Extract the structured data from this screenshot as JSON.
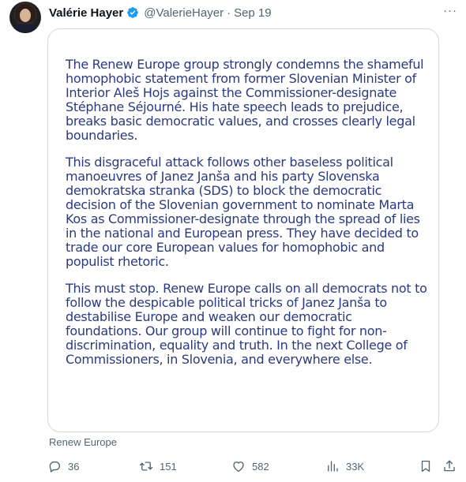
{
  "tweet": {
    "author_name": "Valérie Hayer",
    "handle": "@ValerieHayer",
    "separator": "·",
    "date": "Sep 19",
    "more_label": "···",
    "source_label": "Renew Europe"
  },
  "statement": {
    "paragraphs": [
      "The Renew Europe group strongly condemns the shameful homophobic statement from former Slovenian Minister of Interior Aleš Hojs against the Commissioner-designate Stéphane Séjourné. His hate speech leads to prejudice, breaks basic democratic values, and crosses clearly legal boundaries.",
      "This disgraceful attack follows other baseless political manoeuvres of Janez Janša and his party Slovenska demokratska stranka (SDS) to block the democratic decision of the Slovenian government to nominate Marta Kos as Commissioner-designate through the spread of lies in the national and European press. They have decided to trade our core European values for homophobic and populist rhetoric.",
      "This must stop. Renew Europe calls on all democrats not to follow the despicable political tricks of Janez Janša to destabilise Europe and weaken our democratic foundations. Our group will continue to fight for non-discrimination, equality and truth. In the next College of Commissioners, in Slovenia, and everywhere else."
    ]
  },
  "actions": {
    "replies": "36",
    "reposts": "151",
    "likes": "582",
    "views": "33K"
  },
  "colors": {
    "statement_text": "#2b3a7e",
    "verified_badge": "#1d9bf0",
    "muted": "#536471",
    "border": "#cfd9de"
  },
  "icons": [
    "verified-badge-icon",
    "more-icon",
    "reply-icon",
    "repost-icon",
    "like-icon",
    "views-icon",
    "bookmark-icon",
    "share-icon"
  ]
}
